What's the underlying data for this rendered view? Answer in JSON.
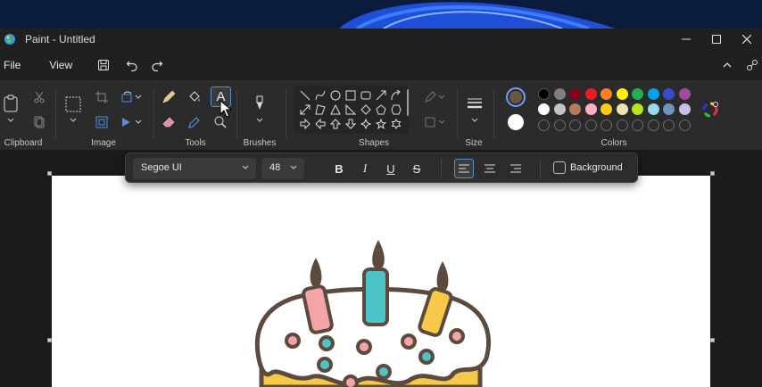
{
  "window": {
    "title": "Paint - Untitled"
  },
  "menu": {
    "file": "File",
    "view": "View"
  },
  "ribbon": {
    "groups": {
      "clipboard": "Clipboard",
      "image": "Image",
      "tools": "Tools",
      "brushes": "Brushes",
      "shapes": "Shapes",
      "size": "Size",
      "colors": "Colors"
    },
    "selected_tool": "text-tool"
  },
  "colors": {
    "primary": "#6b5746",
    "secondary": "#ffffff",
    "palette_row1": [
      "#000000",
      "#7f7f7f",
      "#880015",
      "#ed1c24",
      "#ff7f27",
      "#fff200",
      "#22b14c",
      "#00a2e8",
      "#3f48cc",
      "#a349a4"
    ],
    "palette_row2": [
      "#ffffff",
      "#c3c3c3",
      "#b97a57",
      "#ffaec9",
      "#ffc90e",
      "#efe4b0",
      "#b5e61d",
      "#99d9ea",
      "#7092be",
      "#c8bfe7"
    ]
  },
  "text_toolbar": {
    "font": "Segoe UI",
    "size": "48",
    "background_label": "Background",
    "alignment": "left"
  },
  "illustration": {
    "outline": "#5b4a3d",
    "candle_colors": [
      "#f4a3a8",
      "#4cc3c7",
      "#f7c948"
    ],
    "dot_colors": [
      "#f4a3a8",
      "#4cc3c7"
    ],
    "cake_side": "#f7c948"
  }
}
